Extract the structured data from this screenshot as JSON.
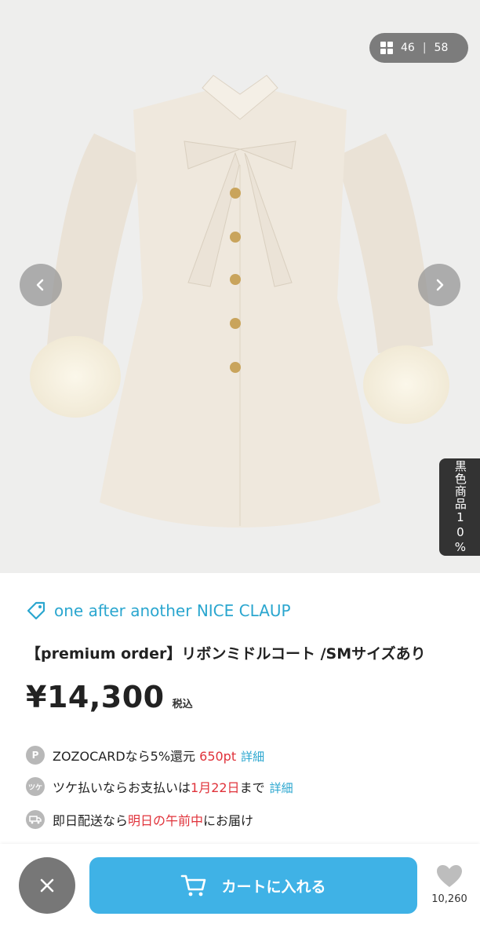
{
  "gallery": {
    "current": "46",
    "separator": "|",
    "total": "58",
    "promo_tab": "黒色商品10%"
  },
  "product": {
    "brand": "one after another NICE CLAUP",
    "title": "【premium order】リボンミドルコート /SMサイズあり",
    "price": "¥14,300",
    "tax_label": "税込"
  },
  "info": {
    "points": {
      "icon_text": "P",
      "text": "ZOZOCARDなら5%還元 ",
      "highlight": "650pt",
      "link": "詳細"
    },
    "deferred": {
      "icon_text": "ツケ",
      "text": "ツケ払いならお支払いは",
      "highlight": "1月22日",
      "suffix": "まで",
      "link": "詳細"
    },
    "delivery": {
      "text": "即日配送なら",
      "highlight": "明日の午前中",
      "suffix": "にお届け"
    }
  },
  "actions": {
    "cart_label": "カートに入れる",
    "favorite_count": "10,260"
  },
  "colors": {
    "accent": "#3fb2e6",
    "brand": "#2aa6cf",
    "highlight": "#e0323a"
  }
}
